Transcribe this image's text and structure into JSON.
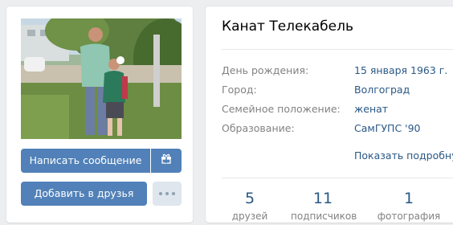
{
  "profile": {
    "name": "Канат Телекабель",
    "info": [
      {
        "label": "День рождения:",
        "value": "15 января 1963 г."
      },
      {
        "label": "Город:",
        "value": "Волгоград"
      },
      {
        "label": "Семейное положение:",
        "value": "женат"
      },
      {
        "label": "Образование:",
        "value": "СамГУПС '90"
      }
    ],
    "show_more": "Показать подробную"
  },
  "actions": {
    "message": "Написать сообщение",
    "add_friend": "Добавить в друзья",
    "gift_icon": "gift-icon",
    "more_icon": "more-dots-icon"
  },
  "counters": [
    {
      "num": "5",
      "label": "друзей"
    },
    {
      "num": "11",
      "label": "подписчиков"
    },
    {
      "num": "1",
      "label": "фотография"
    }
  ],
  "colors": {
    "accent": "#5181b8",
    "link": "#2a5885",
    "label": "#828282",
    "background": "#edeef0"
  }
}
